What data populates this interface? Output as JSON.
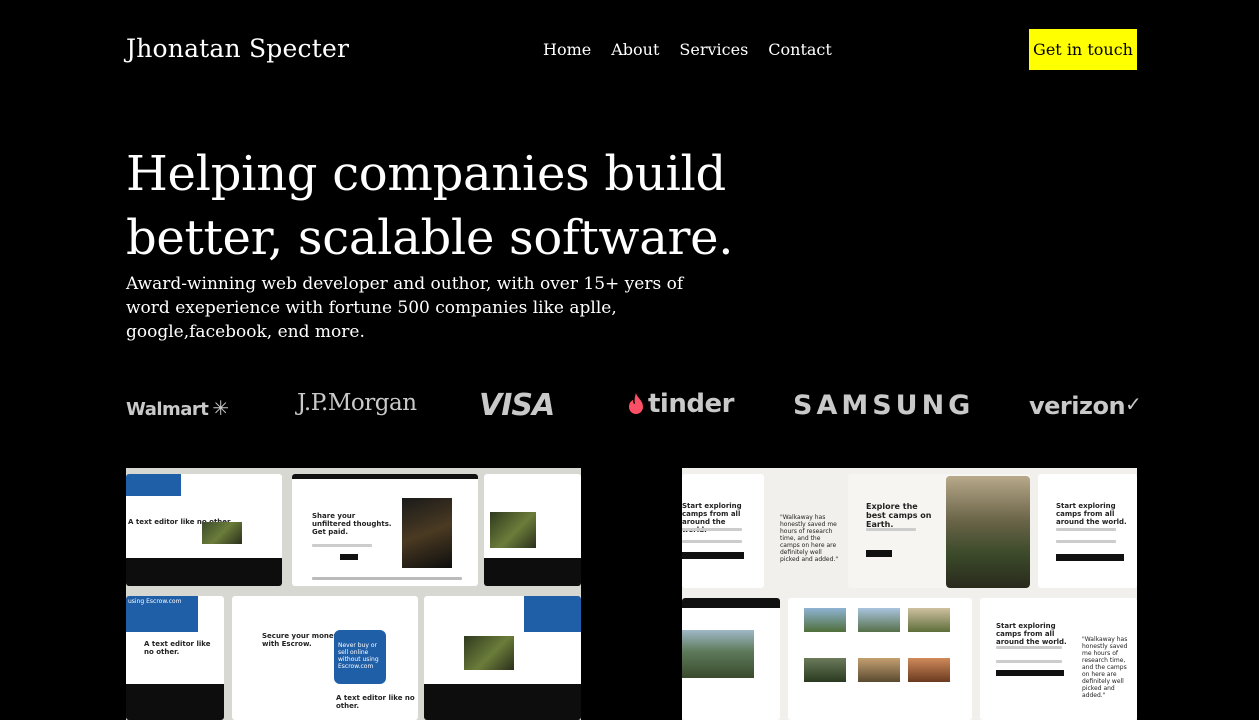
{
  "header": {
    "brand": "Jhonatan Specter",
    "nav": [
      "Home",
      "About",
      "Services",
      "Contact"
    ],
    "cta_label": "Get in touch"
  },
  "hero": {
    "title": "Helping companies build better, scalable software.",
    "subtitle": "Award-winning web developer and outhor, with over 15+ yers of word exeperience with fortune 500 companies like aplle, google,facebook, end more."
  },
  "logos": {
    "walmart": "Walmart",
    "jpmorgan": "J.P.Morgan",
    "visa": "VISA",
    "tinder": "tinder",
    "samsung": "SAMSUNG",
    "verizon": "verizon"
  },
  "portfolio": {
    "left": {
      "headline_1": "Share your unfiltered thoughts. Get paid.",
      "headline_2": "Secure your money with Escrow.",
      "headline_3": "Never buy or sell online without using Escrow.com",
      "text_editor": "A text editor like no other.",
      "using_escrow": "using Escrow.com"
    },
    "right": {
      "headline_1": "Explore the best camps on Earth.",
      "headline_2": "Start exploring camps from all around the world.",
      "quote": "\"Walkaway has honestly saved me hours of research time, and the camps on here are definitely well picked and added.\""
    }
  },
  "colors": {
    "background": "#000000",
    "accent": "#ffff00",
    "logo_grey": "#c9c9c9",
    "tinder_flame": "#fd4f66"
  }
}
